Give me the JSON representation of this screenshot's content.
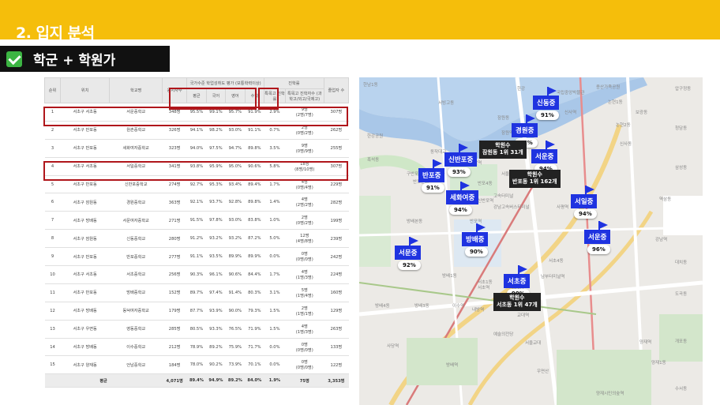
{
  "header": {
    "title": "2. 입지 분석"
  },
  "subtitle": {
    "text": "학군 + 학원가"
  },
  "table": {
    "group_headers": {
      "eval": "국가수준 학업성취도 평가 (보통학력이상)",
      "advance": "진학률"
    },
    "headers": [
      "순위",
      "위치",
      "학교명",
      "응시자수",
      "평균",
      "국어",
      "영어",
      "수학",
      "특목고 진학률",
      "특목고 진학자수 (과학고/외고/국제고)",
      "졸업자 수"
    ],
    "rows": [
      [
        "1",
        "서초구 서초동",
        "서운중학교",
        "348명",
        "95.5%",
        "99.1%",
        "95.7%",
        "91.9%",
        "2.9%",
        "9명\n(2명/7명)",
        "307명"
      ],
      [
        "2",
        "서초구 반포동",
        "원촌중학교",
        "326명",
        "94.1%",
        "98.2%",
        "93.0%",
        "91.1%",
        "0.7%",
        "2명\n(0명/2명)",
        "262명"
      ],
      [
        "3",
        "서초구 반포동",
        "세화여자중학교",
        "323명",
        "94.0%",
        "97.5%",
        "94.7%",
        "89.8%",
        "3.5%",
        "9명\n(0명/9명)",
        "255명"
      ],
      [
        "4",
        "서초구 서초동",
        "서일중학교",
        "341명",
        "93.8%",
        "95.9%",
        "95.0%",
        "90.6%",
        "5.8%",
        "18명\n(8명/10명)",
        "307명"
      ],
      [
        "5",
        "서초구 반포동",
        "신반포중학교",
        "274명",
        "92.7%",
        "95.3%",
        "93.4%",
        "89.4%",
        "1.7%",
        "4명\n(0명/4명)",
        "229명"
      ],
      [
        "6",
        "서초구 잠원동",
        "경원중학교",
        "363명",
        "92.1%",
        "93.7%",
        "92.8%",
        "89.8%",
        "1.4%",
        "4명\n(2명/2명)",
        "282명"
      ],
      [
        "7",
        "서초구 방배동",
        "서문여자중학교",
        "271명",
        "91.5%",
        "97.8%",
        "93.0%",
        "83.8%",
        "1.0%",
        "2명\n(0명/2명)",
        "199명"
      ],
      [
        "8",
        "서초구 잠원동",
        "신동중학교",
        "280명",
        "91.2%",
        "93.2%",
        "93.2%",
        "87.2%",
        "5.0%",
        "12명\n(4명/8명)",
        "239명"
      ],
      [
        "9",
        "서초구 반포동",
        "반포중학교",
        "277명",
        "91.1%",
        "93.5%",
        "89.9%",
        "89.9%",
        "0.0%",
        "0명\n(0명/0명)",
        "242명"
      ],
      [
        "10",
        "서초구 서초동",
        "서초중학교",
        "256명",
        "90.3%",
        "96.1%",
        "90.6%",
        "84.4%",
        "1.7%",
        "4명\n(1명/3명)",
        "224명"
      ],
      [
        "11",
        "서초구 반포동",
        "방배중학교",
        "152명",
        "89.7%",
        "97.4%",
        "91.4%",
        "80.3%",
        "3.1%",
        "5명\n(1명/4명)",
        "160명"
      ],
      [
        "12",
        "서초구 방배동",
        "동덕여자중학교",
        "179명",
        "87.7%",
        "93.9%",
        "90.0%",
        "79.3%",
        "1.5%",
        "2명\n(1명/1명)",
        "129명"
      ],
      [
        "13",
        "서초구 우면동",
        "영동중학교",
        "285명",
        "80.5%",
        "93.3%",
        "76.5%",
        "71.9%",
        "1.5%",
        "4명\n(1명/3명)",
        "263명"
      ],
      [
        "14",
        "서초구 방배동",
        "이수중학교",
        "212명",
        "78.9%",
        "89.2%",
        "75.9%",
        "71.7%",
        "0.0%",
        "0명\n(0명/0명)",
        "133명"
      ],
      [
        "15",
        "서초구 양재동",
        "언남중학교",
        "184명",
        "78.0%",
        "90.2%",
        "73.9%",
        "70.1%",
        "0.0%",
        "0명\n(0명/0명)",
        "122명"
      ]
    ],
    "avg": {
      "label": "평균",
      "count": "4,071명",
      "avg": "89.4%",
      "kor": "94.9%",
      "eng": "89.2%",
      "math": "84.0%",
      "rate": "1.9%",
      "advanced": "75명",
      "grads": "3,353명"
    }
  },
  "map": {
    "schools": [
      {
        "name": "신동중",
        "pct": "91%"
      },
      {
        "name": "경원중",
        "pct": "92%"
      },
      {
        "name": "신반포중",
        "pct": "93%"
      },
      {
        "name": "서운중",
        "pct": "94%"
      },
      {
        "name": "반포중",
        "pct": "91%"
      },
      {
        "name": "세화여중",
        "pct": "94%"
      },
      {
        "name": "서일중",
        "pct": "94%"
      },
      {
        "name": "방배중",
        "pct": "90%"
      },
      {
        "name": "서운중",
        "pct": "96%"
      },
      {
        "name": "서문중",
        "pct": "92%"
      },
      {
        "name": "서초중",
        "pct": "90%"
      }
    ],
    "academies": [
      {
        "line1": "학원수",
        "line2": "잠원동 1위 31개"
      },
      {
        "line1": "학원수",
        "line2": "반포동 1위 162개"
      },
      {
        "line1": "학원수",
        "line2": "서초동 1위 47개"
      }
    ],
    "labels": [
      "한남1동",
      "서빙고동",
      "반포본동",
      "반포1동",
      "반포4동",
      "방배본동",
      "방배1동",
      "방배3동",
      "방배4동",
      "서초1동",
      "서초3동",
      "서초4동",
      "잠원동",
      "논현1동",
      "논현2동",
      "신사동",
      "역삼동",
      "양재1동",
      "사당역",
      "이수역",
      "내방역",
      "교대역",
      "강남역",
      "양재역",
      "양재시민의숲역",
      "예술의전당",
      "우면산",
      "서울교대",
      "서초역",
      "반포역",
      "고속터미널",
      "잠원역",
      "신사역",
      "구반포역",
      "동작역",
      "방배역",
      "남부터미널역",
      "서울성모병원",
      "서래마을",
      "강남고속버스터미널",
      "신반포역",
      "사평역",
      "한강공원",
      "흑석동",
      "동작대교",
      "한강",
      "국립중앙박물관",
      "용산가족공원",
      "보광동",
      "압구정동",
      "청담동",
      "삼성동",
      "대치동",
      "도곡동",
      "개포동",
      "수서동"
    ]
  }
}
